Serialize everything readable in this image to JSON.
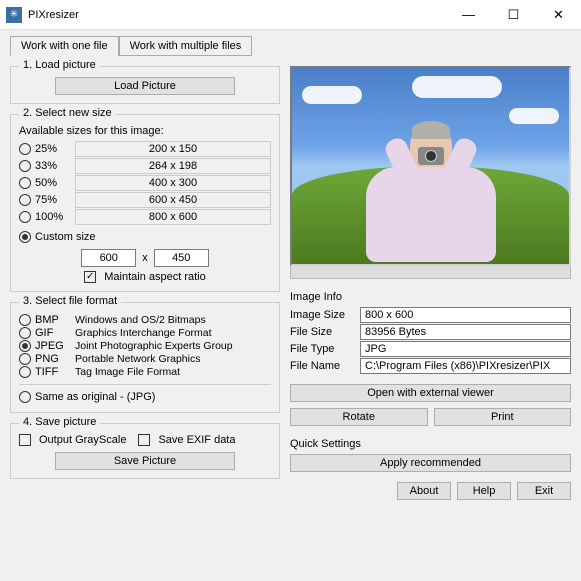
{
  "window": {
    "title": "PIXresizer"
  },
  "tabs": {
    "one": "Work with one file",
    "multi": "Work with multiple files"
  },
  "load": {
    "title": "1. Load picture",
    "button": "Load Picture"
  },
  "size": {
    "title": "2. Select new size",
    "available": "Available sizes for this image:",
    "rows": [
      {
        "pct": "25%",
        "dim": "200  x  150"
      },
      {
        "pct": "33%",
        "dim": "264  x  198"
      },
      {
        "pct": "50%",
        "dim": "400  x  300"
      },
      {
        "pct": "75%",
        "dim": "600  x  450"
      },
      {
        "pct": "100%",
        "dim": "800  x  600"
      }
    ],
    "custom": "Custom size",
    "width": "600",
    "x": "x",
    "height": "450",
    "maintain": "Maintain aspect ratio"
  },
  "format": {
    "title": "3. Select file format",
    "rows": [
      {
        "abbr": "BMP",
        "desc": "Windows and OS/2 Bitmaps"
      },
      {
        "abbr": "GIF",
        "desc": "Graphics Interchange Format"
      },
      {
        "abbr": "JPEG",
        "desc": "Joint Photographic Experts Group"
      },
      {
        "abbr": "PNG",
        "desc": "Portable Network Graphics"
      },
      {
        "abbr": "TIFF",
        "desc": "Tag Image File Format"
      }
    ],
    "same": "Same as original  - (JPG)"
  },
  "save": {
    "title": "4. Save picture",
    "grayscale": "Output GrayScale",
    "exif": "Save EXIF data",
    "button": "Save Picture"
  },
  "info": {
    "head": "Image Info",
    "sizeL": "Image Size",
    "sizeV": "800 x 600",
    "fileL": "File Size",
    "fileV": "83956 Bytes",
    "typeL": "File Type",
    "typeV": "JPG",
    "nameL": "File Name",
    "nameV": "C:\\Program Files (x86)\\PIXresizer\\PIX",
    "open": "Open with external viewer",
    "rotate": "Rotate",
    "print": "Print"
  },
  "quick": {
    "head": "Quick Settings",
    "apply": "Apply recommended"
  },
  "footer": {
    "about": "About",
    "help": "Help",
    "exit": "Exit"
  }
}
